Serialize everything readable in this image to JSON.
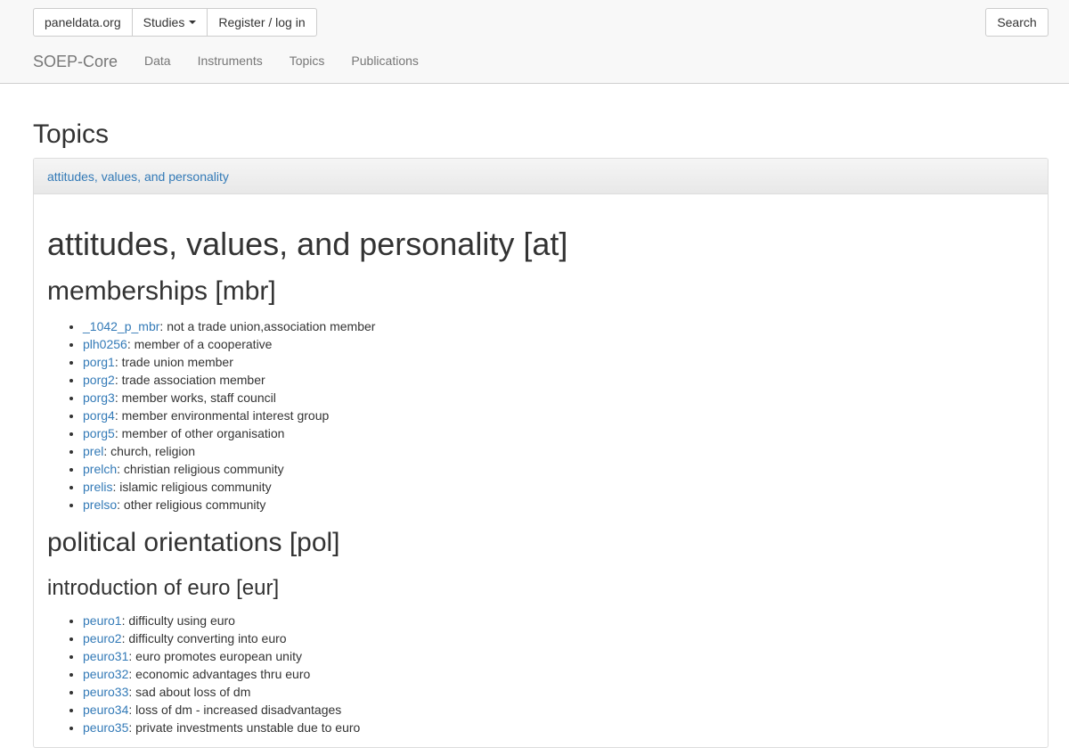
{
  "navbar": {
    "site_button": "paneldata.org",
    "studies_button": "Studies",
    "register_button": "Register / log in",
    "search_button": "Search",
    "brand": "SOEP-Core",
    "links": [
      "Data",
      "Instruments",
      "Topics",
      "Publications"
    ]
  },
  "page": {
    "title": "Topics",
    "breadcrumb": "attitudes, values, and personality"
  },
  "topic": {
    "title": "attitudes, values, and personality [at]",
    "subtopics": [
      {
        "title": "memberships [mbr]",
        "items": [
          {
            "code": "_1042_p_mbr",
            "label": "not a trade union,association member"
          },
          {
            "code": "plh0256",
            "label": "member of a cooperative"
          },
          {
            "code": "porg1",
            "label": "trade union member"
          },
          {
            "code": "porg2",
            "label": "trade association member"
          },
          {
            "code": "porg3",
            "label": "member works, staff council"
          },
          {
            "code": "porg4",
            "label": "member environmental interest group"
          },
          {
            "code": "porg5",
            "label": "member of other organisation"
          },
          {
            "code": "prel",
            "label": "church, religion"
          },
          {
            "code": "prelch",
            "label": "christian religious community"
          },
          {
            "code": "prelis",
            "label": "islamic religious community"
          },
          {
            "code": "prelso",
            "label": "other religious community"
          }
        ]
      },
      {
        "title": "political orientations [pol]",
        "subsection": {
          "title": "introduction of euro [eur]",
          "items": [
            {
              "code": "peuro1",
              "label": "difficulty using euro"
            },
            {
              "code": "peuro2",
              "label": "difficulty converting into euro"
            },
            {
              "code": "peuro31",
              "label": "euro promotes european unity"
            },
            {
              "code": "peuro32",
              "label": "economic advantages thru euro"
            },
            {
              "code": "peuro33",
              "label": "sad about loss of dm"
            },
            {
              "code": "peuro34",
              "label": "loss of dm - increased disadvantages"
            },
            {
              "code": "peuro35",
              "label": "private investments unstable due to euro"
            }
          ]
        }
      }
    ]
  }
}
